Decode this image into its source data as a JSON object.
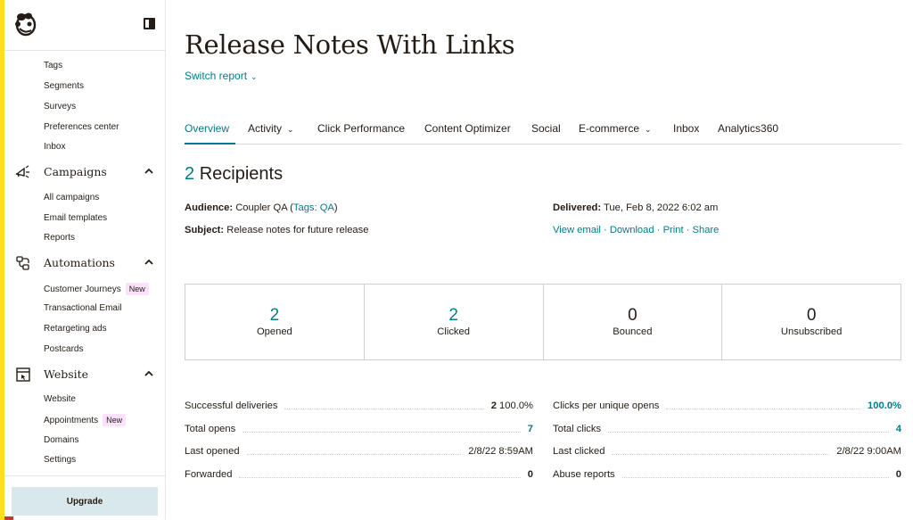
{
  "sidebar": {
    "collapse_icon": "panel-toggle-icon",
    "audience_items": [
      {
        "label": "Tags"
      },
      {
        "label": "Segments"
      },
      {
        "label": "Surveys"
      },
      {
        "label": "Preferences center"
      },
      {
        "label": "Inbox"
      }
    ],
    "campaigns": {
      "label": "Campaigns",
      "icon": "megaphone-icon",
      "items": [
        {
          "label": "All campaigns"
        },
        {
          "label": "Email templates"
        },
        {
          "label": "Reports"
        }
      ]
    },
    "automations": {
      "label": "Automations",
      "icon": "automation-icon",
      "items": [
        {
          "label": "Customer Journeys",
          "badge": "New"
        },
        {
          "label": "Transactional Email"
        },
        {
          "label": "Retargeting ads"
        },
        {
          "label": "Postcards"
        }
      ]
    },
    "website": {
      "label": "Website",
      "icon": "website-icon",
      "items": [
        {
          "label": "Website"
        },
        {
          "label": "Appointments",
          "badge": "New"
        },
        {
          "label": "Domains"
        },
        {
          "label": "Settings"
        }
      ]
    },
    "upgrade_label": "Upgrade"
  },
  "header": {
    "title": "Release Notes With Links",
    "switch_report": "Switch report"
  },
  "tabs": [
    {
      "label": "Overview",
      "active": true
    },
    {
      "label": "Activity",
      "dropdown": true
    },
    {
      "label": "Click Performance"
    },
    {
      "label": "Content Optimizer"
    },
    {
      "label": "Social"
    },
    {
      "label": "E-commerce",
      "dropdown": true
    },
    {
      "label": "Inbox"
    },
    {
      "label": "Analytics360"
    }
  ],
  "summary": {
    "recipients_count": "2",
    "recipients_label": "Recipients",
    "audience_label": "Audience:",
    "audience_value": "Coupler QA (",
    "audience_tags_link": "Tags: QA",
    "audience_close": ")",
    "subject_label": "Subject:",
    "subject_value": "Release notes for future release",
    "delivered_label": "Delivered:",
    "delivered_value": "Tue, Feb 8, 2022 6:02 am",
    "links": {
      "view_email": "View email",
      "download": "Download",
      "print": "Print",
      "share": "Share",
      "separator": " · "
    }
  },
  "stats": [
    {
      "value": "2",
      "label": "Opened"
    },
    {
      "value": "2",
      "label": "Clicked"
    },
    {
      "value": "0",
      "label": "Bounced"
    },
    {
      "value": "0",
      "label": "Unsubscribed"
    }
  ],
  "details_left": [
    {
      "label": "Successful deliveries",
      "value_bold": "2",
      "value": "100.0%"
    },
    {
      "label": "Total opens",
      "value": "7"
    },
    {
      "label": "Last opened",
      "value": "2/8/22 8:59AM"
    },
    {
      "label": "Forwarded",
      "value": "0"
    }
  ],
  "details_right": [
    {
      "label": "Clicks per unique opens",
      "value": "100.0%"
    },
    {
      "label": "Total clicks",
      "value": "4"
    },
    {
      "label": "Last clicked",
      "value": "2/8/22 9:00AM"
    },
    {
      "label": "Abuse reports",
      "value": "0"
    }
  ],
  "colors": {
    "accent": "#007c89",
    "brand_yellow": "#ffe01b",
    "text": "#241c15",
    "upgrade_bg": "#d9e8eb",
    "badge_bg": "#fbe1fb"
  }
}
